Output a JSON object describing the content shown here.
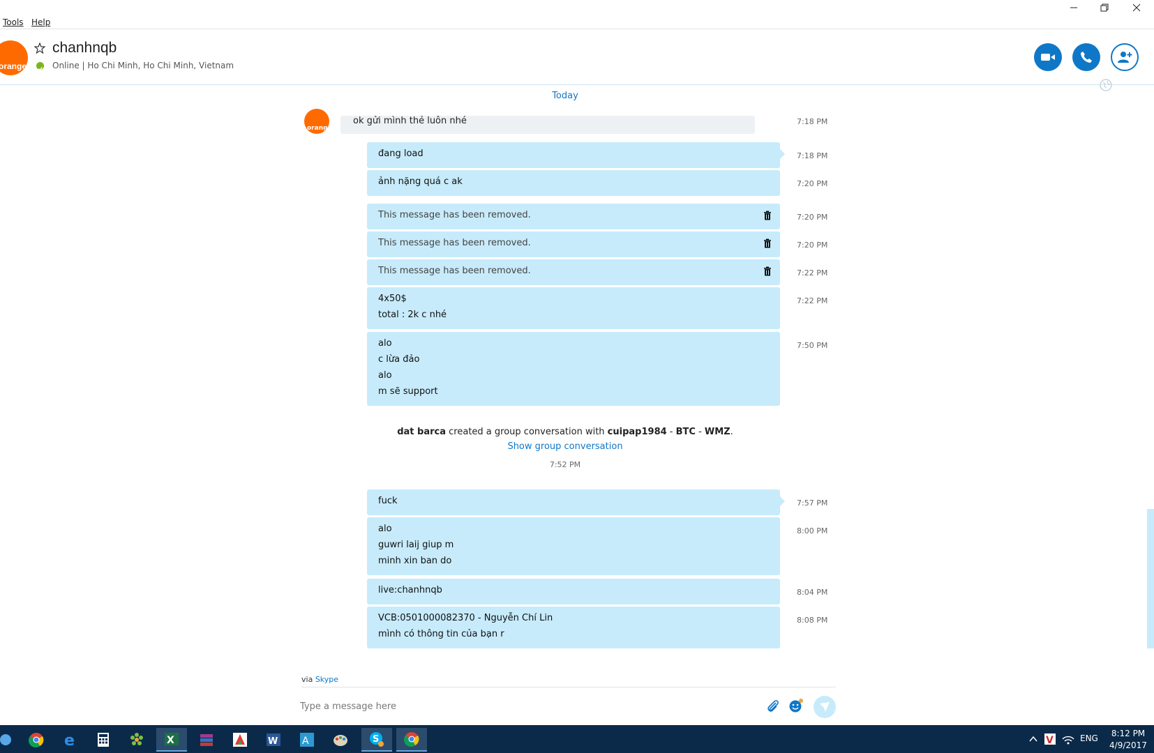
{
  "menu": {
    "items": [
      "Tools",
      "Help"
    ]
  },
  "header": {
    "avatar_text": "orange",
    "contact_name": "chanhnqb",
    "status": "Online",
    "location": "Ho Chi Minh, Ho Chi Minh, Vietnam",
    "status_line": "Online  |  Ho Chi Minh, Ho Chi Minh, Vietnam",
    "accent_color": "#0f77c7",
    "status_color": "#7cb518"
  },
  "chat": {
    "date_divider": "Today",
    "incoming": {
      "avatar_text": "orange",
      "text": "ok gửi mình thẻ luôn nhé",
      "time": "7:18 PM"
    },
    "messages": [
      {
        "lines": [
          "đang load"
        ],
        "time": "7:18 PM",
        "removed": false
      },
      {
        "lines": [
          "ảnh nặng quá c ak"
        ],
        "time": "7:20 PM",
        "removed": false
      },
      {
        "lines": [
          "This message has been removed."
        ],
        "time": "7:20 PM",
        "removed": true
      },
      {
        "lines": [
          "This message has been removed."
        ],
        "time": "7:20 PM",
        "removed": true
      },
      {
        "lines": [
          "This message has been removed."
        ],
        "time": "7:22 PM",
        "removed": true
      },
      {
        "lines": [
          "4x50$",
          "total : 2k c nhé"
        ],
        "time": "7:22 PM",
        "removed": false
      },
      {
        "lines": [
          "alo",
          "c lừa đảo",
          "alo",
          "m sẽ support"
        ],
        "time": "7:50 PM",
        "removed": false
      },
      {
        "lines": [
          "fuck"
        ],
        "time": "7:57 PM",
        "removed": false
      },
      {
        "lines": [
          "alo",
          "guwri laij giup m",
          "minh xin ban do"
        ],
        "time": "8:00 PM",
        "removed": false
      },
      {
        "lines": [
          "live:chanhnqb"
        ],
        "time": "8:04 PM",
        "removed": false
      },
      {
        "lines": [
          "VCB:0501000082370 - Nguyễn Chí Lin",
          "mình có thông tin của bạn r"
        ],
        "time": "8:08 PM",
        "removed": false
      }
    ],
    "group_notice": {
      "creator": "dat barca",
      "action": "created a group conversation with",
      "member1": "cuipap1984",
      "sep": " - ",
      "member2": "BTC",
      "member3": "WMZ",
      "link": "Show group conversation",
      "time": "7:52 PM"
    }
  },
  "composer": {
    "via_prefix": "via",
    "via_link": "Skype",
    "placeholder": "Type a message here"
  },
  "taskbar": {
    "apps": [
      "skype-partial",
      "chrome",
      "edge",
      "calculator",
      "icq",
      "excel",
      "winrar",
      "foxit",
      "word",
      "paint",
      "paint-3d",
      "skype",
      "chrome-2"
    ],
    "lang": "ENG",
    "time": "8:12 PM",
    "date": "4/9/2017"
  }
}
